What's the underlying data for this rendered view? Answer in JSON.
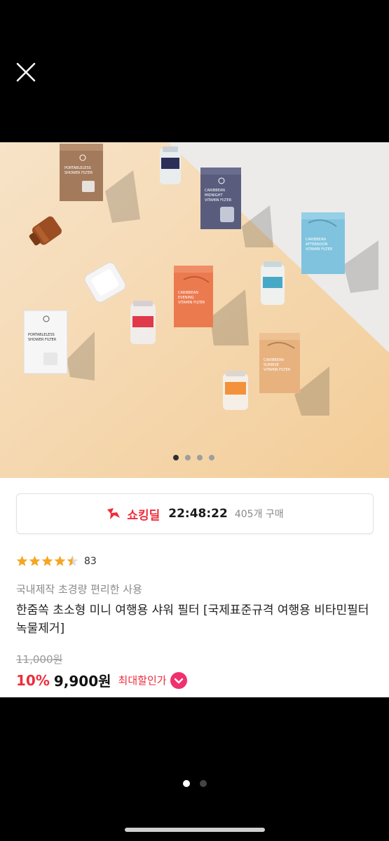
{
  "viewer": {
    "close_icon": "close-icon",
    "page_dots": {
      "count": 2,
      "active_index": 0
    }
  },
  "product_image": {
    "carousel": {
      "count": 4,
      "active_index": 0
    },
    "package_texts": {
      "portable_brown": [
        "PORTABLELESS",
        "SHOWER FILTER"
      ],
      "portable_white": [
        "PORTABLELESS",
        "SHOWER FILTER"
      ],
      "caribbean_midnight": [
        "CARIBBEAN",
        "MIDNIGHT",
        "VITAMIN FILTER"
      ],
      "caribbean_evening": [
        "CARIBBEAN",
        "EVENING",
        "VITAMIN FILTER"
      ],
      "caribbean_afternoon": [
        "CARIBBEAN",
        "AFTERNOON",
        "VITAMIN FILTER"
      ],
      "caribbean_sunrise": [
        "CARIBBEAN",
        "SUNRISE",
        "VITAMIN FILTER"
      ]
    }
  },
  "deal": {
    "icon": "shocking-deal-icon",
    "label": "쇼킹딜",
    "timer": "22:48:22",
    "purchase_count": "405개 구매"
  },
  "rating": {
    "score": 4.5,
    "count": "83"
  },
  "product": {
    "subtitle": "국내제작 초경량 편리한 사용",
    "title": "한줌쏙 초소형 미니 여행용 샤워 필터 [국제표준규격 여행용 비타민필터 녹물제거]"
  },
  "price": {
    "original": "11,000원",
    "discount": "10%",
    "sale": "9,900원",
    "max_discount_label": "최대할인가",
    "max_discount_icon": "chevron-down-icon"
  },
  "colors": {
    "accent_red": "#ee2d3b",
    "star_gold": "#f5a623",
    "badge_pink": "#f0306e"
  }
}
